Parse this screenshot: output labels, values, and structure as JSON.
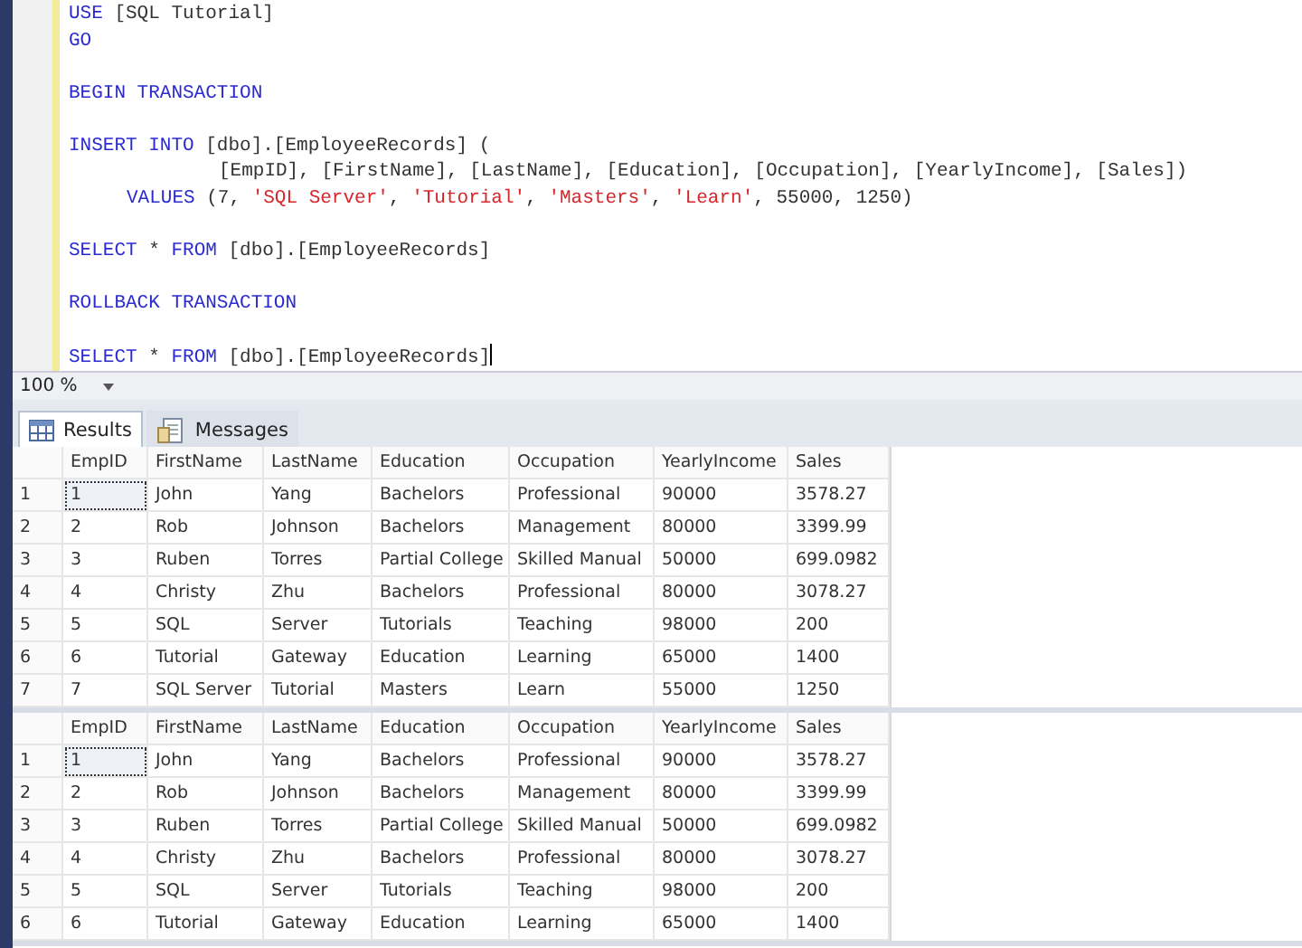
{
  "editor": {
    "lines": [
      {
        "kind": "statement",
        "tokens": [
          {
            "kind": "keyword",
            "text": "USE"
          },
          {
            "kind": "plain",
            "text": " [SQL Tutorial]"
          }
        ]
      },
      {
        "kind": "statement",
        "tokens": [
          {
            "kind": "keyword",
            "text": "GO"
          }
        ]
      },
      {
        "kind": "blank"
      },
      {
        "kind": "statement",
        "tokens": [
          {
            "kind": "keyword",
            "text": "BEGIN TRANSACTION"
          }
        ]
      },
      {
        "kind": "blank"
      },
      {
        "kind": "statement",
        "tokens": [
          {
            "kind": "keyword",
            "text": "INSERT INTO"
          },
          {
            "kind": "plain",
            "text": " [dbo].[EmployeeRecords] ("
          }
        ]
      },
      {
        "kind": "column_list",
        "tokens": [
          {
            "kind": "plain",
            "text": "[EmpID], [FirstName], [LastName], [Education], [Occupation], [YearlyIncome], [Sales])"
          }
        ]
      },
      {
        "kind": "values_clause",
        "tokens": [
          {
            "kind": "keyword",
            "text": "VALUES"
          },
          {
            "kind": "plain",
            "text": " (7, "
          },
          {
            "kind": "string",
            "text": "'SQL Server'"
          },
          {
            "kind": "plain",
            "text": ", "
          },
          {
            "kind": "string",
            "text": "'Tutorial'"
          },
          {
            "kind": "plain",
            "text": ", "
          },
          {
            "kind": "string",
            "text": "'Masters'"
          },
          {
            "kind": "plain",
            "text": ", "
          },
          {
            "kind": "string",
            "text": "'Learn'"
          },
          {
            "kind": "plain",
            "text": ", 55000, 1250)"
          }
        ]
      },
      {
        "kind": "blank"
      },
      {
        "kind": "statement",
        "tokens": [
          {
            "kind": "keyword",
            "text": "SELECT"
          },
          {
            "kind": "plain",
            "text": " * "
          },
          {
            "kind": "keyword",
            "text": "FROM"
          },
          {
            "kind": "plain",
            "text": " [dbo].[EmployeeRecords]"
          }
        ]
      },
      {
        "kind": "blank"
      },
      {
        "kind": "statement",
        "tokens": [
          {
            "kind": "keyword",
            "text": "ROLLBACK TRANSACTION"
          }
        ]
      },
      {
        "kind": "blank"
      },
      {
        "kind": "statement",
        "tokens": [
          {
            "kind": "keyword",
            "text": "SELECT"
          },
          {
            "kind": "plain",
            "text": " * "
          },
          {
            "kind": "keyword",
            "text": "FROM"
          },
          {
            "kind": "plain",
            "text": " [dbo].[EmployeeRecords]"
          }
        ]
      }
    ]
  },
  "zoom": {
    "value": "100 %"
  },
  "tabs": [
    {
      "label": "Results",
      "kind": "grid",
      "selected": true
    },
    {
      "label": "Messages",
      "kind": "text",
      "selected": false
    }
  ],
  "grids": [
    {
      "columns": [
        "EmpID",
        "FirstName",
        "LastName",
        "Education",
        "Occupation",
        "YearlyIncome",
        "Sales"
      ],
      "rows": [
        {
          "number": "1",
          "selected": true,
          "cells": [
            "1",
            "John",
            "Yang",
            "Bachelors",
            "Professional",
            "90000",
            "3578.27"
          ]
        },
        {
          "number": "2",
          "selected": false,
          "cells": [
            "2",
            "Rob",
            "Johnson",
            "Bachelors",
            "Management",
            "80000",
            "3399.99"
          ]
        },
        {
          "number": "3",
          "selected": false,
          "cells": [
            "3",
            "Ruben",
            "Torres",
            "Partial College",
            "Skilled Manual",
            "50000",
            "699.0982"
          ]
        },
        {
          "number": "4",
          "selected": false,
          "cells": [
            "4",
            "Christy",
            "Zhu",
            "Bachelors",
            "Professional",
            "80000",
            "3078.27"
          ]
        },
        {
          "number": "5",
          "selected": false,
          "cells": [
            "5",
            "SQL",
            "Server",
            "Tutorials",
            "Teaching",
            "98000",
            "200"
          ]
        },
        {
          "number": "6",
          "selected": false,
          "cells": [
            "6",
            "Tutorial",
            "Gateway",
            "Education",
            "Learning",
            "65000",
            "1400"
          ]
        },
        {
          "number": "7",
          "selected": false,
          "cells": [
            "7",
            "SQL Server",
            "Tutorial",
            "Masters",
            "Learn",
            "55000",
            "1250"
          ]
        }
      ]
    },
    {
      "columns": [
        "EmpID",
        "FirstName",
        "LastName",
        "Education",
        "Occupation",
        "YearlyIncome",
        "Sales"
      ],
      "rows": [
        {
          "number": "1",
          "selected": true,
          "cells": [
            "1",
            "John",
            "Yang",
            "Bachelors",
            "Professional",
            "90000",
            "3578.27"
          ]
        },
        {
          "number": "2",
          "selected": false,
          "cells": [
            "2",
            "Rob",
            "Johnson",
            "Bachelors",
            "Management",
            "80000",
            "3399.99"
          ]
        },
        {
          "number": "3",
          "selected": false,
          "cells": [
            "3",
            "Ruben",
            "Torres",
            "Partial College",
            "Skilled Manual",
            "50000",
            "699.0982"
          ]
        },
        {
          "number": "4",
          "selected": false,
          "cells": [
            "4",
            "Christy",
            "Zhu",
            "Bachelors",
            "Professional",
            "80000",
            "3078.27"
          ]
        },
        {
          "number": "5",
          "selected": false,
          "cells": [
            "5",
            "SQL",
            "Server",
            "Tutorials",
            "Teaching",
            "98000",
            "200"
          ]
        },
        {
          "number": "6",
          "selected": false,
          "cells": [
            "6",
            "Tutorial",
            "Gateway",
            "Education",
            "Learning",
            "65000",
            "1400"
          ]
        }
      ]
    }
  ]
}
